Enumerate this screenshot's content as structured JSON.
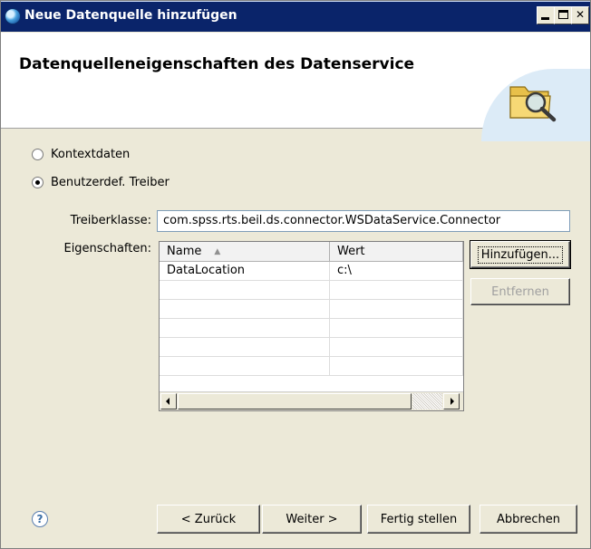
{
  "window": {
    "title": "Neue Datenquelle hinzufügen",
    "app_icon": "globe-icon"
  },
  "header": {
    "heading": "Datenquelleneigenschaften des Datenservice",
    "icon": "folder-search-icon"
  },
  "options": {
    "radio_context": "Kontextdaten",
    "radio_custom": "Benutzerdef. Treiber",
    "selected": "Benutzerdef. Treiber"
  },
  "form": {
    "driver_label": "Treiberklasse:",
    "driver_value": "com.spss.rts.beil.ds.connector.WSDataService.Connector",
    "properties_label": "Eigenschaften:"
  },
  "properties_table": {
    "columns": [
      "Name",
      "Wert"
    ],
    "rows": [
      {
        "name": "DataLocation",
        "wert": "c:\\"
      }
    ]
  },
  "side_buttons": {
    "add": "Hinzufügen...",
    "remove": "Entfernen"
  },
  "footer": {
    "help_icon": "help-icon",
    "back": "< Zurück",
    "next": "Weiter >",
    "finish": "Fertig stellen",
    "cancel": "Abbrechen"
  }
}
